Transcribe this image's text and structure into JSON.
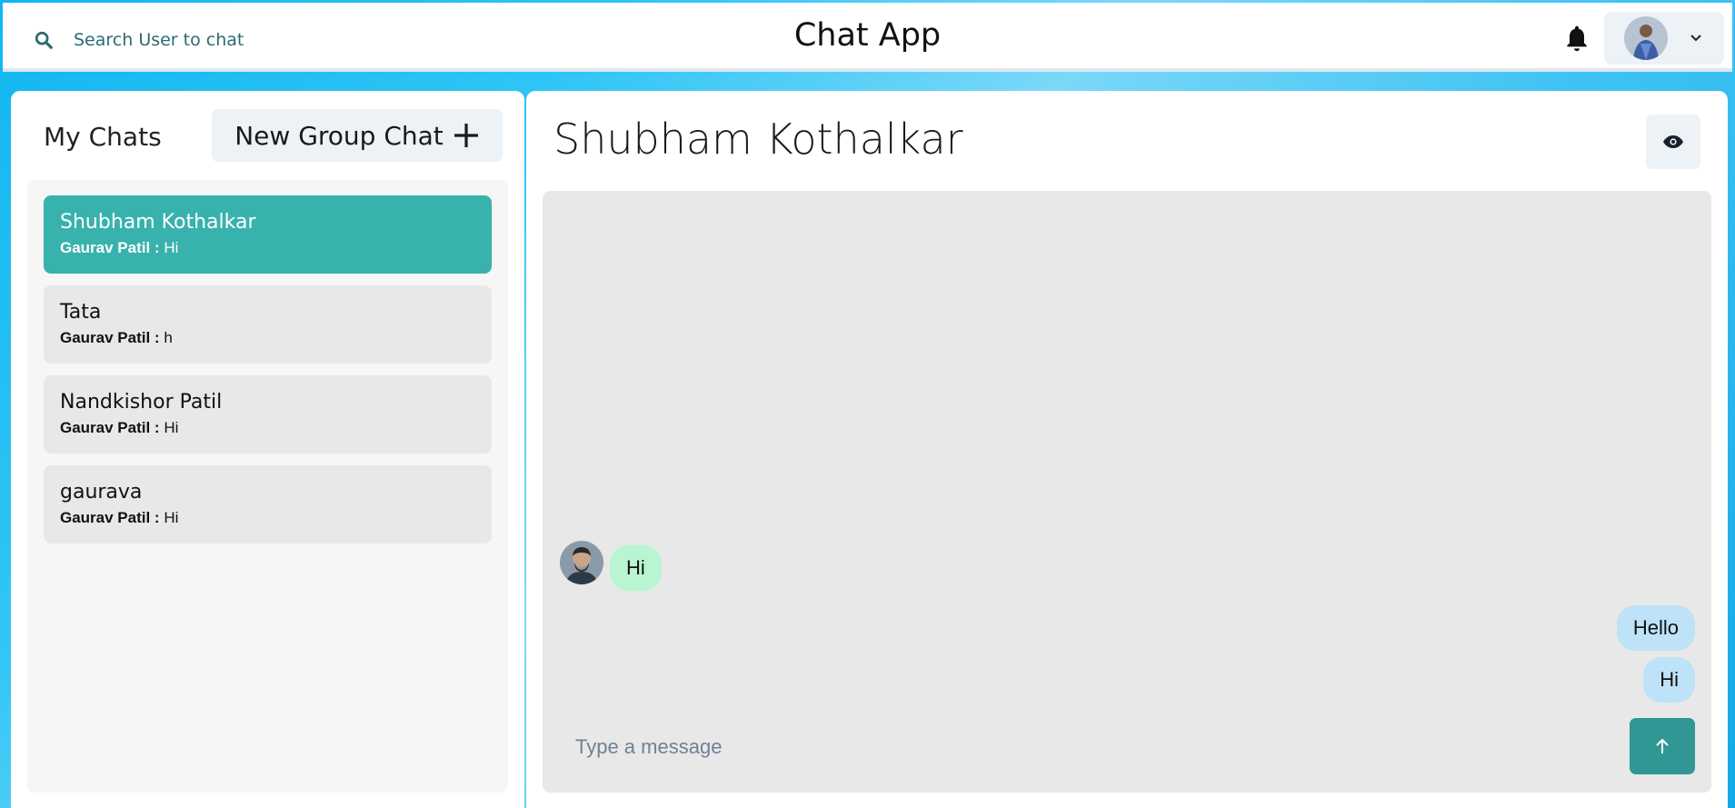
{
  "header": {
    "search_label": "Search User to chat",
    "app_title": "Chat App"
  },
  "sidebar": {
    "title": "My Chats",
    "new_group_label": "New Group Chat",
    "chats": [
      {
        "name": "Shubham Kothalkar",
        "sender": "Gaurav Patil :",
        "latest": "Hi",
        "selected": true
      },
      {
        "name": "Tata",
        "sender": "Gaurav Patil :",
        "latest": "h",
        "selected": false
      },
      {
        "name": "Nandkishor Patil",
        "sender": "Gaurav Patil :",
        "latest": "Hi",
        "selected": false
      },
      {
        "name": "gaurava",
        "sender": "Gaurav Patil :",
        "latest": "Hi",
        "selected": false
      }
    ]
  },
  "chat": {
    "title": "Shubham Kothalkar",
    "messages": [
      {
        "text": "Hi",
        "direction": "incoming"
      },
      {
        "text": "Hello",
        "direction": "outgoing"
      },
      {
        "text": "Hi",
        "direction": "outgoing"
      }
    ],
    "input_placeholder": "Type a message"
  },
  "colors": {
    "selected_chat": "#38b2ac",
    "incoming_bubble": "#b9f5d0",
    "outgoing_bubble": "#bee3f8",
    "send_button": "#319795"
  },
  "icons": [
    "search-icon",
    "bell-icon",
    "chevron-down-icon",
    "plus-icon",
    "eye-icon",
    "arrow-up-icon"
  ]
}
